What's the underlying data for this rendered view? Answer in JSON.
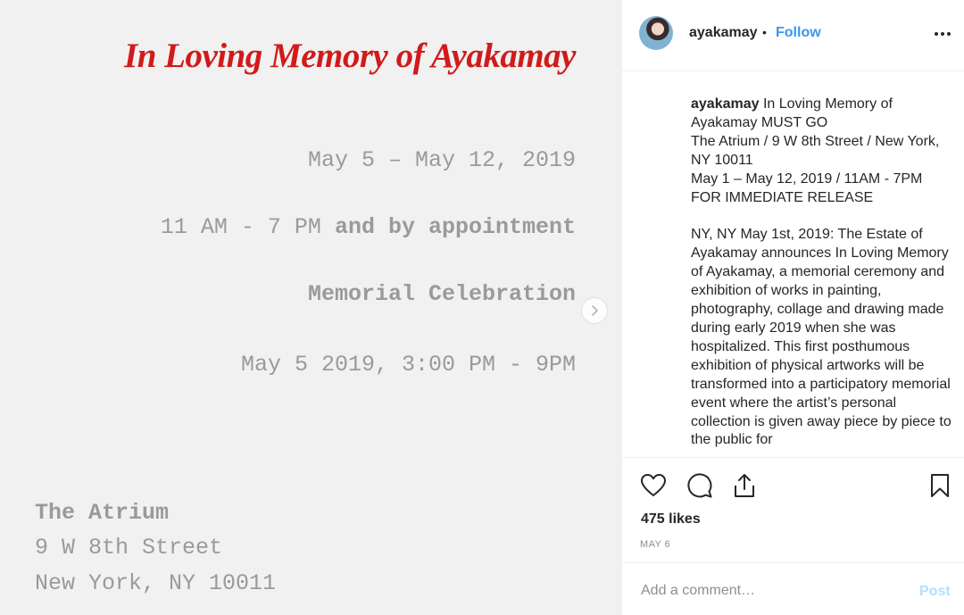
{
  "image": {
    "title": "In Loving Memory of Ayakamay",
    "dates": "May 5 – May 12, 2019",
    "hours_plain": "11 AM - 7 PM",
    "hours_bold": "and by appointment",
    "celebration": "Memorial Celebration",
    "celebration_time": "May 5 2019, 3:00 PM - 9PM",
    "venue": "The Atrium",
    "street": "9 W 8th Street",
    "city": "New York, NY 10011",
    "title_color": "#d11a1a"
  },
  "header": {
    "username": "ayakamay",
    "separator": "•",
    "follow_label": "Follow",
    "follow_color": "#3897f0"
  },
  "caption": {
    "username": "ayakamay",
    "lines": [
      "In Loving Memory of Ayakamay MUST GO",
      "The Atrium / 9 W 8th Street / New York, NY 10011",
      "May 1 – May 12, 2019 / 11AM - 7PM",
      "FOR IMMEDIATE RELEASE"
    ],
    "body": "NY, NY May 1st, 2019: The Estate of Ayakamay announces In Loving Memory of Ayakamay, a memorial ceremony and exhibition of works in painting, photography, collage and drawing made during early 2019 when she was hospitalized. This first posthumous exhibition of physical artworks will be transformed into a participatory memorial event where the artist’s personal collection is given away piece by piece to the public for"
  },
  "actions": {
    "like_icon": "heart-icon",
    "comment_icon": "comment-icon",
    "share_icon": "share-icon",
    "save_icon": "bookmark-icon",
    "likes": "475 likes",
    "date": "MAY 6"
  },
  "comment": {
    "placeholder": "Add a comment…",
    "post_label": "Post"
  }
}
